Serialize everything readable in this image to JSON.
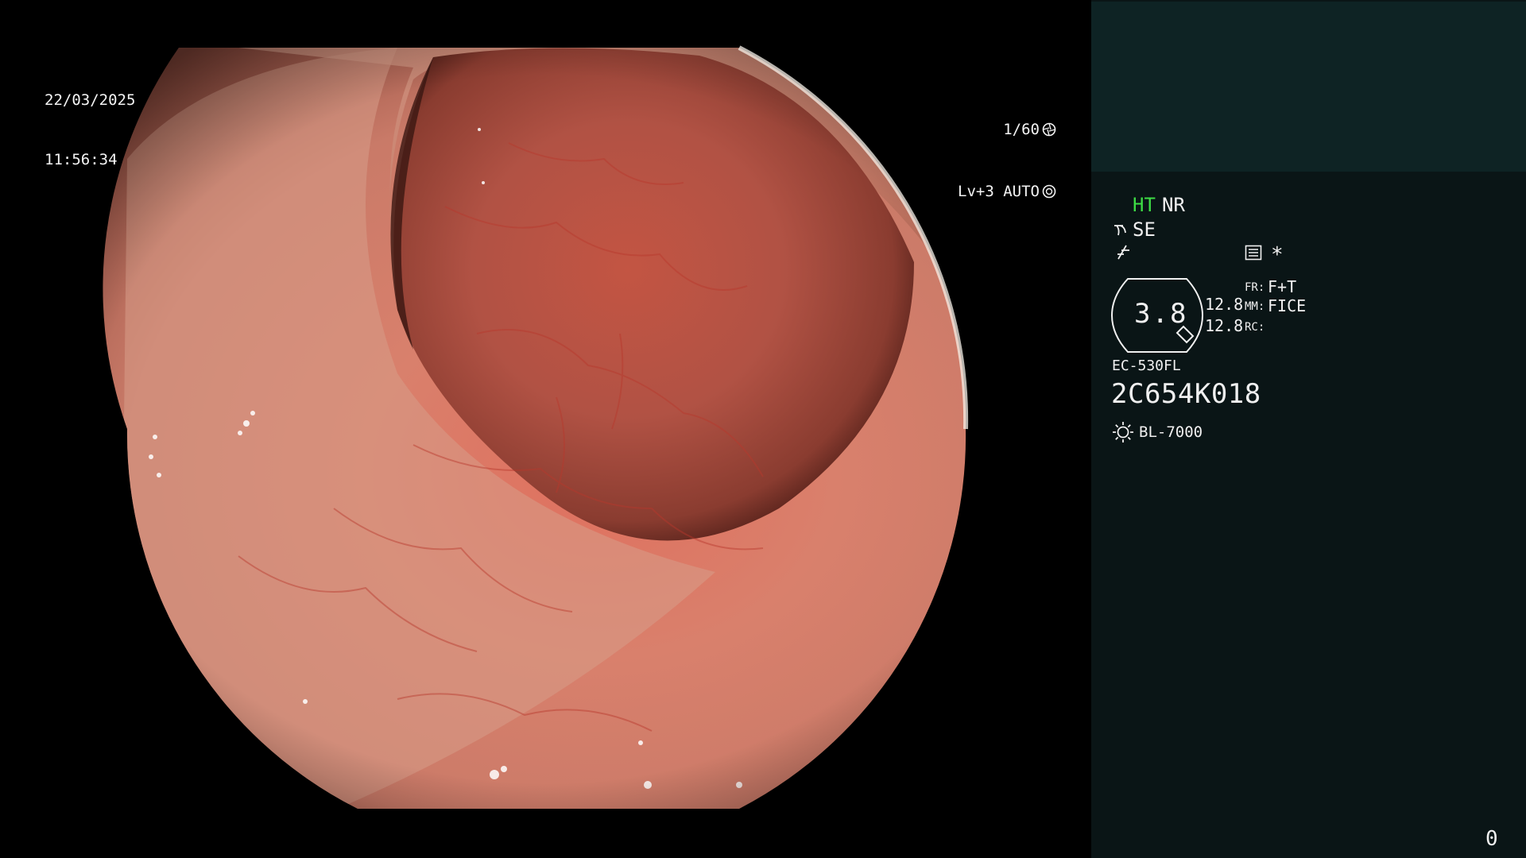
{
  "video": {
    "date": "22/03/2025",
    "time": "11:56:34",
    "shutter": "1/60",
    "iris": "Lv+3 AUTO"
  },
  "panel": {
    "mode_ht": "HT",
    "mode_nr": "NR",
    "se_label": "SE",
    "star": "*",
    "zoom_value": "3.8",
    "value_a": "12.8",
    "value_b": "12.8",
    "label_fr": "FR:",
    "label_mm": "MM:",
    "label_rc": "RC:",
    "fr_value": "F+T",
    "mm_value": "FICE",
    "scope_model": "EC-530FL",
    "scope_serial": "2C654K018",
    "light_source": "BL-7000",
    "counter": "0"
  },
  "colors": {
    "panel_bg": "#0a1516",
    "panel_top_bg": "#0e2324",
    "ht_green": "#3ddc45",
    "text": "#f0f0f0"
  },
  "icons": [
    "shutter-icon",
    "iris-icon",
    "scope-angle-icon",
    "flag-icon",
    "menu-icon",
    "light-bulb-icon"
  ]
}
